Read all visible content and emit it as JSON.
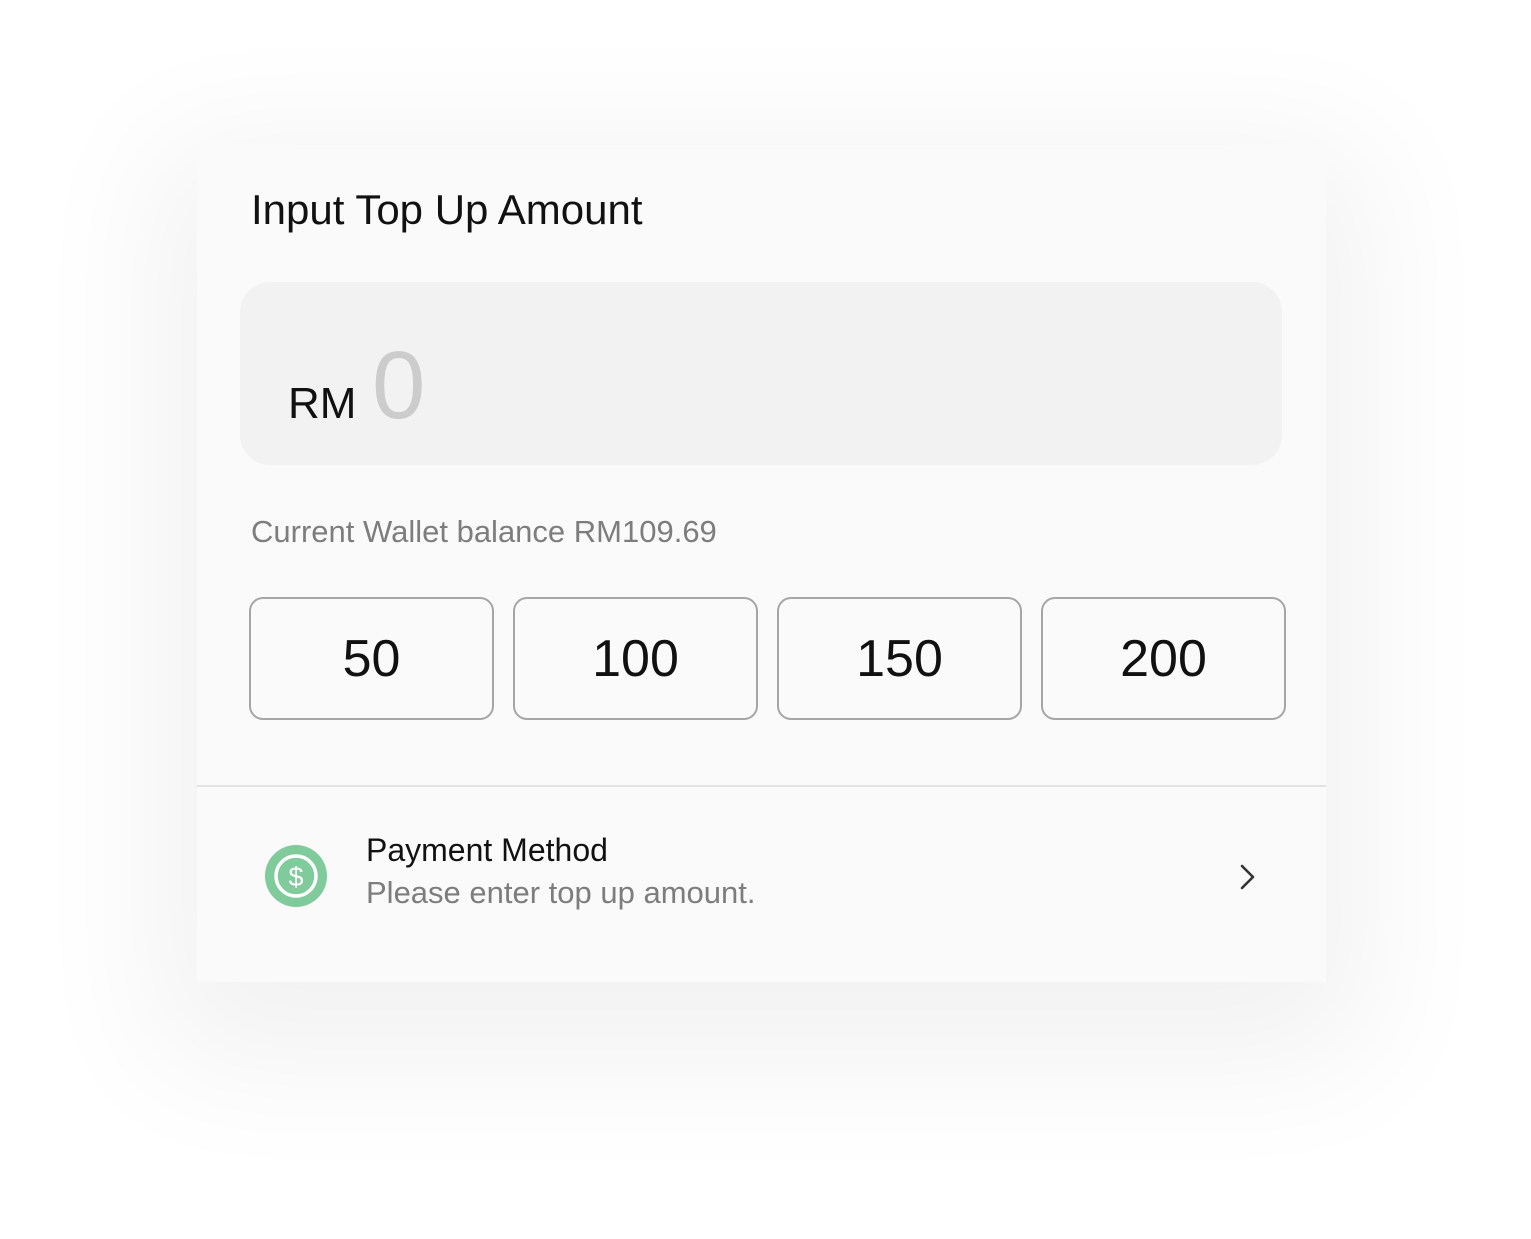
{
  "header": {
    "title": "Input Top Up Amount"
  },
  "amount_input": {
    "currency": "RM",
    "value": "0"
  },
  "balance_text": "Current Wallet balance RM109.69",
  "presets": [
    "50",
    "100",
    "150",
    "200"
  ],
  "payment": {
    "title": "Payment Method",
    "subtitle": "Please enter top up amount.",
    "icon": "dollar-coin-icon",
    "icon_color": "#7fcb9c",
    "chevron_icon": "chevron-right-icon"
  },
  "colors": {
    "background": "#fafafa",
    "input_background": "#f2f2f2",
    "placeholder": "#cccccc",
    "secondary_text": "#7d7d7d",
    "accent_green": "#7fcb9c"
  }
}
